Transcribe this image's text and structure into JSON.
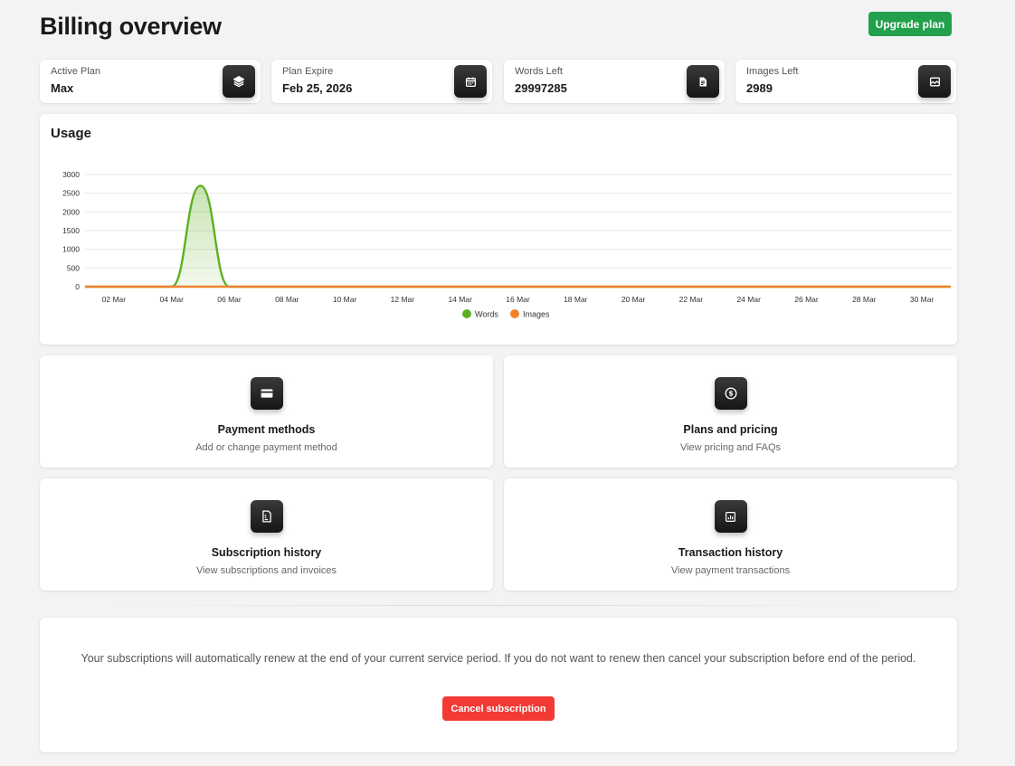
{
  "header": {
    "title": "Billing overview",
    "upgrade_label": "Upgrade plan"
  },
  "stats": [
    {
      "label": "Active Plan",
      "value": "Max",
      "icon": "layers-icon"
    },
    {
      "label": "Plan Expire",
      "value": "Feb 25, 2026",
      "icon": "calendar-icon"
    },
    {
      "label": "Words Left",
      "value": "29997285",
      "icon": "document-icon"
    },
    {
      "label": "Images Left",
      "value": "2989",
      "icon": "image-icon"
    }
  ],
  "usage": {
    "title": "Usage"
  },
  "tiles": [
    {
      "title": "Payment methods",
      "subtitle": "Add or change payment method",
      "icon": "credit-card-icon"
    },
    {
      "title": "Plans and pricing",
      "subtitle": "View pricing and FAQs",
      "icon": "dollar-coin-icon"
    },
    {
      "title": "Subscription history",
      "subtitle": "View subscriptions and invoices",
      "icon": "receipt-icon"
    },
    {
      "title": "Transaction history",
      "subtitle": "View payment transactions",
      "icon": "bar-chart-icon"
    }
  ],
  "notice": {
    "text": "Your subscriptions will automatically renew at the end of your current service period. If you do not want to renew then cancel your subscription before end of the period.",
    "cancel_label": "Cancel subscription"
  },
  "colors": {
    "accent_green": "#22a04b",
    "danger_red": "#f23a35",
    "words_series": "#5fb021",
    "images_series": "#f0822c"
  },
  "chart_data": {
    "type": "area",
    "title": "",
    "x": [
      "01 Mar",
      "02 Mar",
      "03 Mar",
      "04 Mar",
      "05 Mar",
      "06 Mar",
      "07 Mar",
      "08 Mar",
      "09 Mar",
      "10 Mar",
      "11 Mar",
      "12 Mar",
      "13 Mar",
      "14 Mar",
      "15 Mar",
      "16 Mar",
      "17 Mar",
      "18 Mar",
      "19 Mar",
      "20 Mar",
      "21 Mar",
      "22 Mar",
      "23 Mar",
      "24 Mar",
      "25 Mar",
      "26 Mar",
      "27 Mar",
      "28 Mar",
      "29 Mar",
      "30 Mar",
      "31 Mar"
    ],
    "x_tick_labels": [
      "02 Mar",
      "04 Mar",
      "06 Mar",
      "08 Mar",
      "10 Mar",
      "12 Mar",
      "14 Mar",
      "16 Mar",
      "18 Mar",
      "20 Mar",
      "22 Mar",
      "24 Mar",
      "26 Mar",
      "28 Mar",
      "30 Mar"
    ],
    "y_ticks": [
      0,
      500,
      1000,
      1500,
      2000,
      2500,
      3000
    ],
    "ylim": [
      0,
      3000
    ],
    "grid": true,
    "legend": "bottom-center",
    "series": [
      {
        "name": "Words",
        "color": "#5fb021",
        "values": [
          0,
          0,
          0,
          0,
          2700,
          0,
          0,
          0,
          0,
          0,
          0,
          0,
          0,
          0,
          0,
          0,
          0,
          0,
          0,
          0,
          0,
          0,
          0,
          0,
          0,
          0,
          0,
          0,
          0,
          0,
          0
        ]
      },
      {
        "name": "Images",
        "color": "#f0822c",
        "values": [
          0,
          0,
          0,
          0,
          0,
          0,
          0,
          0,
          0,
          0,
          0,
          0,
          0,
          0,
          0,
          0,
          0,
          0,
          0,
          0,
          0,
          0,
          0,
          0,
          0,
          0,
          0,
          0,
          0,
          0,
          0
        ]
      }
    ]
  }
}
